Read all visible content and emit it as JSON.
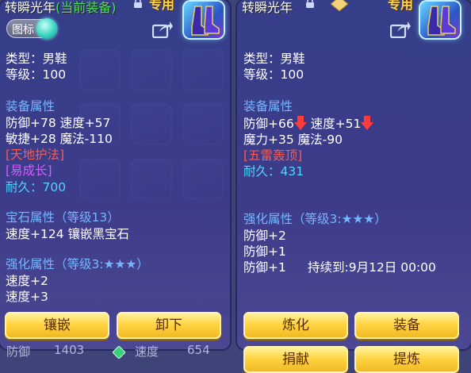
{
  "left_panel": {
    "item_name": "转瞬光年",
    "current_tag": "(当前装备)",
    "status": "专用",
    "toggle_label": "图标",
    "type_line": "类型：男鞋",
    "level_line": "等级：100",
    "attr_header": "装备属性",
    "attr_lines": [
      "防御+78 速度+57",
      "敏捷+28 魔法-110"
    ],
    "special_1": "[天地护法]",
    "special_2": "[易成长]",
    "durability": "耐久：700",
    "gem_header": "宝石属性（等级13）",
    "gem_line": "速度+124 镶嵌黑宝石",
    "enhance_header": "强化属性（等级3:★★★）",
    "enhance_lines": [
      "速度+2",
      "速度+3"
    ],
    "buttons": {
      "inlay": "镶嵌",
      "unequip": "卸下"
    },
    "bottom_left_label": "防御",
    "bottom_left_value": "1403",
    "bottom_right_label": "速度",
    "bottom_right_value": "654"
  },
  "right_panel": {
    "item_name": "转瞬光年",
    "status": "专用",
    "type_line": "类型：男鞋",
    "level_line": "等级：100",
    "attr_header": "装备属性",
    "attr_line_1_a": "防御+66",
    "attr_line_1_b": "速度+51",
    "attr_line_2": "魔力+35 魔法-90",
    "special_1": "[五雷轰顶]",
    "durability": "耐久：431",
    "enhance_header": "强化属性（等级3:★★★）",
    "enhance_lines": [
      "防御+2",
      "防御+1"
    ],
    "enhance_last": "防御+1",
    "duration": "持续到:9月12日 00:00",
    "buttons": {
      "refine": "炼化",
      "equip": "装备",
      "donate": "捐献",
      "extract": "提炼"
    }
  },
  "colors": {
    "white": "#ffffff",
    "blue_header": "#75b6ff",
    "red_special": "#ff5a4a",
    "purple_special": "#d65cff",
    "cyan_durability": "#4ad6ff",
    "current_green": "#48e05a",
    "button_gold": "#ffd545"
  },
  "icons": [
    "lock-icon",
    "share-icon",
    "boots-icon",
    "down-arrow-icon",
    "gem-icon",
    "badge-icon"
  ]
}
